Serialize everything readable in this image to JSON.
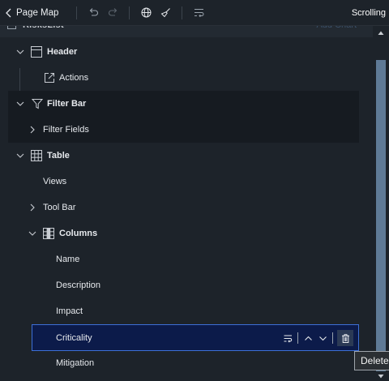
{
  "toolbar": {
    "title": "Page Map",
    "right_label": "Scrolling"
  },
  "card": {
    "title_fragment": "RisksList",
    "add_chart_label": "Add Chart"
  },
  "tree": {
    "items": [
      {
        "label": "Header"
      },
      {
        "label": "Actions"
      },
      {
        "label": "Filter Bar"
      },
      {
        "label": "Filter Fields"
      },
      {
        "label": "Table"
      },
      {
        "label": "Views"
      },
      {
        "label": "Tool Bar"
      },
      {
        "label": "Columns"
      },
      {
        "label": "Name"
      },
      {
        "label": "Description"
      },
      {
        "label": "Impact"
      },
      {
        "label": "Criticality"
      },
      {
        "label": "Mitigation"
      }
    ],
    "selected": "Criticality"
  },
  "tooltip": {
    "text": "Delete"
  },
  "icons": {
    "toolbar": [
      "chevron-left-icon",
      "undo-icon",
      "redo-icon",
      "globe-icon",
      "clear-brush-icon",
      "text-wrap-icon"
    ],
    "row_actions": [
      "text-wrap-icon",
      "chevron-up-icon",
      "chevron-down-icon",
      "trash-icon"
    ]
  },
  "colors": {
    "background": "#1d232a",
    "selected_fill": "#0c1b4a",
    "selected_border": "#3d6fd6",
    "scroll_thumb": "#5f7a96"
  }
}
